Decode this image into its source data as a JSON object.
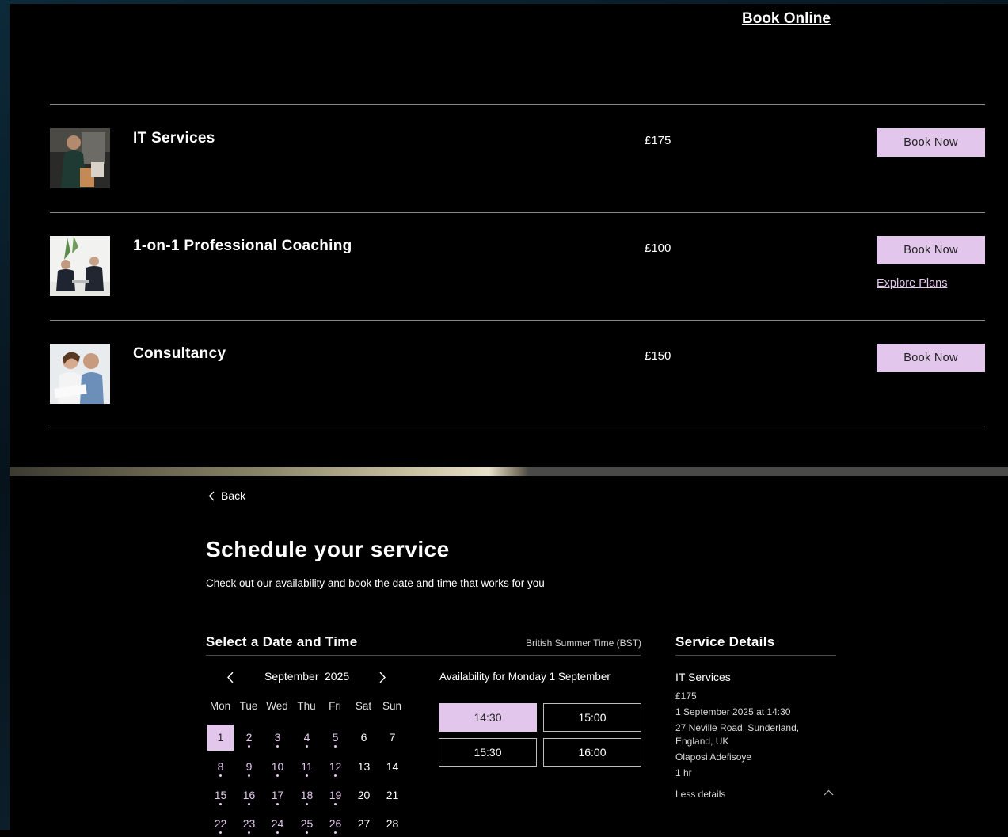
{
  "nav": {
    "book_online": "Book Online"
  },
  "services": [
    {
      "title": "IT Services",
      "price": "£175",
      "button": "Book Now",
      "image_icon": "it-services-photo"
    },
    {
      "title": "1-on-1 Professional Coaching",
      "price": "£100",
      "button": "Book Now",
      "link": "Explore Plans",
      "image_icon": "coaching-photo"
    },
    {
      "title": "Consultancy",
      "price": "£150",
      "button": "Book Now",
      "image_icon": "consultancy-photo"
    }
  ],
  "schedule": {
    "back": "Back",
    "heading": "Schedule your service",
    "subheading": "Check out our availability and book the date and time that works for you",
    "select_title": "Select a Date and Time",
    "timezone": "British Summer Time (BST)",
    "month": "September",
    "year": "2025",
    "weekdays": [
      "Mon",
      "Tue",
      "Wed",
      "Thu",
      "Fri",
      "Sat",
      "Sun"
    ],
    "availability_label": "Availability for Monday 1 September",
    "slots": [
      "14:30",
      "15:00",
      "15:30",
      "16:00"
    ],
    "selected_slot": "14:30",
    "selected_day": "1"
  },
  "details": {
    "title": "Service Details",
    "name": "IT Services",
    "price": "£175",
    "datetime": "1 September 2025 at 14:30",
    "address_line1": "27 Neville Road, Sunderland,",
    "address_line2": "England, UK",
    "staff": "Olaposi Adefisoye",
    "duration": "1 hr",
    "less": "Less details"
  },
  "colors": {
    "accent": "#e3c6ec",
    "background": "#000000",
    "divider": "#8a8a8a"
  }
}
